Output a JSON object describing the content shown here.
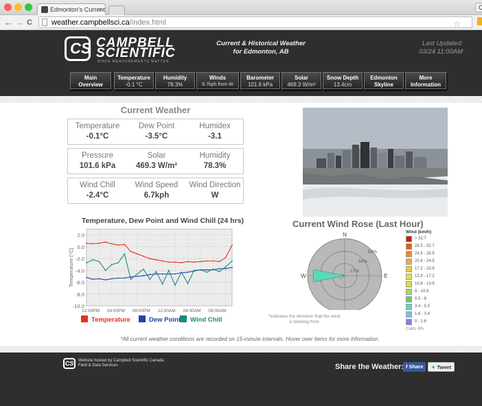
{
  "browser": {
    "tab_title": "Edmonton's Current Weath",
    "tab_close": "×",
    "url_domain": "weather.campbellsci.ca",
    "url_path": "/index.html",
    "right_button": "C",
    "nav_back": "←",
    "nav_forward": "→",
    "nav_reload": "C",
    "star": "☆"
  },
  "header": {
    "brand_line1": "CAMPBELL",
    "brand_line2": "SCIENTIFIC",
    "brand_tagline": "WHEN MEASUREMENTS MATTER",
    "title_line1": "Current & Historical Weather",
    "title_line2": "for Edmonton, AB",
    "updated_label": "Last Updated:",
    "updated_value": "03/24 11:00AM"
  },
  "nav": [
    {
      "title": "Main",
      "value": "Overview",
      "bold_value": true
    },
    {
      "title": "Temperature",
      "value": "-0.1 °C"
    },
    {
      "title": "Humidity",
      "value": "78.3%"
    },
    {
      "title": "Winds",
      "value": "6.7kph from W"
    },
    {
      "title": "Barometer",
      "value": "101.6 kPa"
    },
    {
      "title": "Solar",
      "value": "469.3 W/m²"
    },
    {
      "title": "Snow Depth",
      "value": "13.4cm"
    },
    {
      "title": "Edmonton",
      "value": "Skyline",
      "bold_value": true
    },
    {
      "title": "More",
      "value": "Information",
      "bold_value": true
    }
  ],
  "current": {
    "title": "Current Weather",
    "rows": [
      [
        {
          "label": "Temperature",
          "value": "-0.1°C"
        },
        {
          "label": "Dew Point",
          "value": "-3.5°C"
        },
        {
          "label": "Humidex",
          "value": "-3.1"
        }
      ],
      [
        {
          "label": "Pressure",
          "value": "101.6 kPa"
        },
        {
          "label": "Solar",
          "value": "469.3 W/m²"
        },
        {
          "label": "Humidity",
          "value": "78.3%"
        }
      ],
      [
        {
          "label": "Wind Chill",
          "value": "-2.4°C"
        },
        {
          "label": "Wind Speed",
          "value": "6.7kph"
        },
        {
          "label": "Wind Direction",
          "value": "W"
        }
      ]
    ]
  },
  "chart_data": [
    {
      "type": "line",
      "title": "Temperature, Dew Point and Wind Chill (24 hrs)",
      "ylabel": "Temperature (°C)",
      "ylim": [
        -10,
        3
      ],
      "yticks": [
        "2.0",
        "0.0",
        "-2.0",
        "-4.0",
        "-6.0",
        "-8.0",
        "-10.0"
      ],
      "xticks": [
        "12:00PM",
        "04:00PM",
        "08:00PM",
        "12:00AM",
        "04:00AM",
        "08:00AM"
      ],
      "x_hours": [
        0,
        1,
        2,
        3,
        4,
        5,
        6,
        7,
        8,
        9,
        10,
        11,
        12,
        13,
        14,
        15,
        16,
        17,
        18,
        19,
        20,
        21,
        22,
        23
      ],
      "grid": true,
      "series": [
        {
          "name": "Temperature",
          "color": "#e8311a",
          "values": [
            0.6,
            0.5,
            0.6,
            0.8,
            0.5,
            0.3,
            0.4,
            -0.8,
            -1.2,
            -1.6,
            -2.0,
            -2.2,
            -2.4,
            -2.6,
            -2.6,
            -2.7,
            -2.5,
            -2.6,
            -2.5,
            -2.4,
            -2.4,
            -2.5,
            -1.8,
            0.3
          ]
        },
        {
          "name": "Dew Point",
          "color": "#2244aa",
          "values": [
            -5.2,
            -5.5,
            -5.4,
            -5.6,
            -5.4,
            -5.3,
            -5.3,
            -5.1,
            -5.0,
            -4.9,
            -4.7,
            -4.6,
            -4.6,
            -4.6,
            -4.6,
            -4.4,
            -4.3,
            -4.1,
            -3.9,
            -3.9,
            -3.9,
            -3.7,
            -3.7,
            -3.5
          ]
        },
        {
          "name": "Wind Chill",
          "color": "#1a8a80",
          "values": [
            -2.7,
            -2.2,
            -2.5,
            -4.0,
            -3.0,
            -2.7,
            -1.2,
            -5.5,
            -4.6,
            -3.8,
            -5.5,
            -4.2,
            -6.3,
            -4.0,
            -6.5,
            -4.3,
            -6.2,
            -4.0,
            -3.9,
            -4.3,
            -3.8,
            -4.2,
            -3.4,
            -2.4
          ]
        }
      ]
    },
    {
      "type": "pie",
      "title": "Current Wind Rose (Last Hour)",
      "directions": [
        "N",
        "E",
        "S",
        "W"
      ],
      "ring_labels": [
        "81%",
        "54%",
        "27%"
      ],
      "petals": [
        {
          "direction": "W",
          "percent": 69,
          "color": "#5ed8b8"
        },
        {
          "direction": "WNW",
          "percent": 12,
          "color": "#b9d0e8"
        },
        {
          "direction": "WSW",
          "percent": 6,
          "color": "#b9d0e8"
        }
      ],
      "legend_title": "Wind (km/h)",
      "legend": [
        {
          "label": "> 32.7",
          "color": "#cc1818"
        },
        {
          "label": "28.5 - 32.7",
          "color": "#e06010"
        },
        {
          "label": "24.5 - 28.5",
          "color": "#f08a2a"
        },
        {
          "label": "20.8 - 24.5",
          "color": "#f2ad3c"
        },
        {
          "label": "17.2 - 20.8",
          "color": "#f2c83c"
        },
        {
          "label": "13.9 - 17.2",
          "color": "#ecdc3a"
        },
        {
          "label": "10.8 - 13.9",
          "color": "#d8e048"
        },
        {
          "label": "8 - 10.8",
          "color": "#9ee050"
        },
        {
          "label": "5.5 - 8",
          "color": "#5ed070"
        },
        {
          "label": "3.4 - 5.5",
          "color": "#5ed8b8"
        },
        {
          "label": "1.6 - 3.4",
          "color": "#80c0e8"
        },
        {
          "label": "0 - 1.6",
          "color": "#8080e0"
        }
      ],
      "calm": "Calm: 6%"
    }
  ],
  "rose_note": "*Indicates the direction that the wind is blowing from",
  "footnote": "*All current weather conditions are recorded on 15-minute intervals. Hover over items for more information.",
  "footer": {
    "host_line1": "Website hosted by Campbell Scientific Canada",
    "host_line2": "Field & Data Services",
    "share_title": "Share the Weather:",
    "share_fb": "Share",
    "share_tw": "Tweet"
  },
  "colors": {
    "header_bg": "#2e2e2e",
    "nav_bg": "#333333"
  }
}
